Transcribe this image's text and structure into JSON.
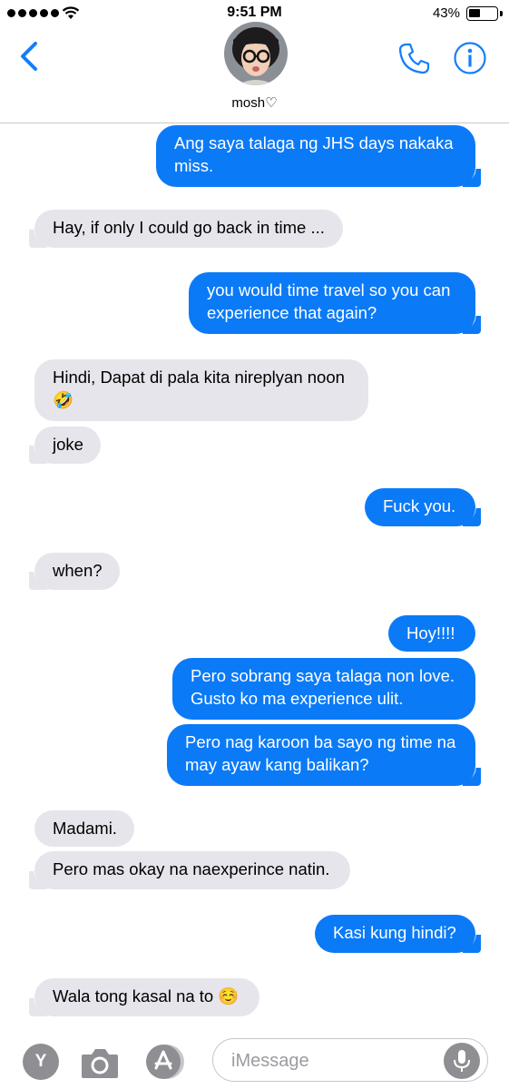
{
  "status_bar": {
    "time": "9:51 PM",
    "battery_percent": "43%",
    "battery_level": 0.43
  },
  "header": {
    "contact_name": "mosh♡"
  },
  "messages": [
    {
      "direction": "out",
      "text": "Ang saya talaga ng JHS days nakaka\nmiss."
    },
    {
      "direction": "in",
      "text": "Hay, if only I could go back in time ..."
    },
    {
      "direction": "out",
      "text": "you would time travel so you can\nexperience that again?"
    },
    {
      "direction": "in",
      "text": "Hindi, Dapat di pala kita nireplyan noon\n🤣"
    },
    {
      "direction": "in",
      "text": "joke"
    },
    {
      "direction": "out",
      "text": "Fuck you."
    },
    {
      "direction": "in",
      "text": "when?"
    },
    {
      "direction": "out",
      "text": "Hoy!!!!"
    },
    {
      "direction": "out",
      "text": "Pero sobrang saya talaga non love.\nGusto ko ma experience ulit."
    },
    {
      "direction": "out",
      "text": "Pero nag karoon ba sayo ng time na\nmay ayaw kang balikan?"
    },
    {
      "direction": "in",
      "text": "Madami."
    },
    {
      "direction": "in",
      "text": "Pero mas okay na naexperince natin."
    },
    {
      "direction": "out",
      "text": "Kasi kung hindi?"
    },
    {
      "direction": "in",
      "text": "Wala tong kasal na to ☺️"
    }
  ],
  "input_bar": {
    "placeholder": "iMessage",
    "y_icon_label": "Y"
  },
  "colors": {
    "outgoing": "#0b7af7",
    "incoming": "#e6e5eb",
    "accent": "#147efb"
  }
}
